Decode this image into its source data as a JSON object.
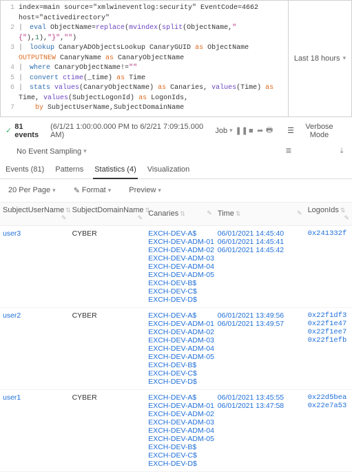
{
  "query": {
    "lines": [
      [
        {
          "t": "plain",
          "v": "index=main source=\"xmlwineventlog:security\" EventCode=4662 host=\"activedirectory\""
        }
      ],
      [
        {
          "t": "pipe",
          "v": "|"
        },
        {
          "t": "cmd",
          "v": " eval "
        },
        {
          "t": "plain",
          "v": "ObjectName="
        },
        {
          "t": "fn",
          "v": "replace"
        },
        {
          "t": "plain",
          "v": "("
        },
        {
          "t": "fn",
          "v": "mvindex"
        },
        {
          "t": "plain",
          "v": "("
        },
        {
          "t": "fn",
          "v": "split"
        },
        {
          "t": "plain",
          "v": "(ObjectName,"
        },
        {
          "t": "str",
          "v": "\"{\""
        },
        {
          "t": "plain",
          "v": "),"
        },
        {
          "t": "num",
          "v": "1"
        },
        {
          "t": "plain",
          "v": "),"
        },
        {
          "t": "str",
          "v": "\"}\""
        },
        {
          "t": "plain",
          "v": ","
        },
        {
          "t": "str",
          "v": "\"\""
        },
        {
          "t": "plain",
          "v": ")"
        }
      ],
      [
        {
          "t": "pipe",
          "v": "|"
        },
        {
          "t": "cmd",
          "v": " lookup "
        },
        {
          "t": "plain",
          "v": "CanaryADObjectsLookup CanaryGUID "
        },
        {
          "t": "kw",
          "v": "as"
        },
        {
          "t": "plain",
          "v": " ObjectName "
        },
        {
          "t": "kw",
          "v": "OUTPUTNEW"
        },
        {
          "t": "plain",
          "v": " CanaryName "
        },
        {
          "t": "kw",
          "v": "as"
        },
        {
          "t": "plain",
          "v": " CanaryObjectName"
        }
      ],
      [
        {
          "t": "pipe",
          "v": "|"
        },
        {
          "t": "cmd",
          "v": " where "
        },
        {
          "t": "plain",
          "v": "CanaryObjectName!="
        },
        {
          "t": "str",
          "v": "\"\""
        }
      ],
      [
        {
          "t": "pipe",
          "v": "|"
        },
        {
          "t": "cmd",
          "v": " convert "
        },
        {
          "t": "fn",
          "v": "ctime"
        },
        {
          "t": "plain",
          "v": "(_time) "
        },
        {
          "t": "kw",
          "v": "as"
        },
        {
          "t": "plain",
          "v": " Time"
        }
      ],
      [
        {
          "t": "pipe",
          "v": "|"
        },
        {
          "t": "cmd",
          "v": " stats "
        },
        {
          "t": "fn",
          "v": "values"
        },
        {
          "t": "plain",
          "v": "(CanaryObjectName) "
        },
        {
          "t": "kw",
          "v": "as"
        },
        {
          "t": "plain",
          "v": " Canaries, "
        },
        {
          "t": "fn",
          "v": "values"
        },
        {
          "t": "plain",
          "v": "(Time) "
        },
        {
          "t": "kw",
          "v": "as"
        },
        {
          "t": "plain",
          "v": " Time, "
        },
        {
          "t": "fn",
          "v": "values"
        },
        {
          "t": "plain",
          "v": "(SubjectLogonId) "
        },
        {
          "t": "kw",
          "v": "as"
        },
        {
          "t": "plain",
          "v": " LogonIds,"
        }
      ],
      [
        {
          "t": "indent",
          "v": "    "
        },
        {
          "t": "kw",
          "v": "by"
        },
        {
          "t": "plain",
          "v": " SubjectUserName,SubjectDomainName"
        }
      ]
    ]
  },
  "time_picker": "Last 18 hours",
  "status": {
    "count_label": "81 events",
    "range": "(6/1/21 1:00:00.000 PM to 6/2/21 7:09:15.000 AM)",
    "job_label": "Job",
    "verbose_label": "Verbose Mode"
  },
  "sampling": {
    "label": "No Event Sampling"
  },
  "tabs": [
    {
      "label": "Events (81)",
      "active": false
    },
    {
      "label": "Patterns",
      "active": false
    },
    {
      "label": "Statistics (4)",
      "active": true
    },
    {
      "label": "Visualization",
      "active": false
    }
  ],
  "toolbar": {
    "perpage": "20 Per Page",
    "format": "Format",
    "preview": "Preview"
  },
  "columns": [
    "SubjectUserName",
    "SubjectDomainName",
    "Canaries",
    "Time",
    "LogonIds"
  ],
  "rows": [
    {
      "user": "user3",
      "domain": "CYBER",
      "canaries": [
        "EXCH-DEV-A$",
        "EXCH-DEV-ADM-01",
        "EXCH-DEV-ADM-02",
        "EXCH-DEV-ADM-03",
        "EXCH-DEV-ADM-04",
        "EXCH-DEV-ADM-05",
        "EXCH-DEV-B$",
        "EXCH-DEV-C$",
        "EXCH-DEV-D$"
      ],
      "time": [
        "06/01/2021 14:45:40",
        "06/01/2021 14:45:41",
        "06/01/2021 14:45:42"
      ],
      "logon": [
        "0x241332f"
      ]
    },
    {
      "user": "user2",
      "domain": "CYBER",
      "canaries": [
        "EXCH-DEV-A$",
        "EXCH-DEV-ADM-01",
        "EXCH-DEV-ADM-02",
        "EXCH-DEV-ADM-03",
        "EXCH-DEV-ADM-04",
        "EXCH-DEV-ADM-05",
        "EXCH-DEV-B$",
        "EXCH-DEV-C$",
        "EXCH-DEV-D$"
      ],
      "time": [
        "06/01/2021 13:49:56",
        "06/01/2021 13:49:57"
      ],
      "logon": [
        "0x22f1df3",
        "0x22f1e47",
        "0x22f1ee7",
        "0x22f1efb"
      ]
    },
    {
      "user": "user1",
      "domain": "CYBER",
      "canaries": [
        "EXCH-DEV-A$",
        "EXCH-DEV-ADM-01",
        "EXCH-DEV-ADM-02",
        "EXCH-DEV-ADM-03",
        "EXCH-DEV-ADM-04",
        "EXCH-DEV-ADM-05",
        "EXCH-DEV-B$",
        "EXCH-DEV-C$",
        "EXCH-DEV-D$"
      ],
      "time": [
        "06/01/2021 13:45:55",
        "06/01/2021 13:47:58"
      ],
      "logon": [
        "0x22d5bea",
        "0x22e7a53"
      ]
    }
  ]
}
